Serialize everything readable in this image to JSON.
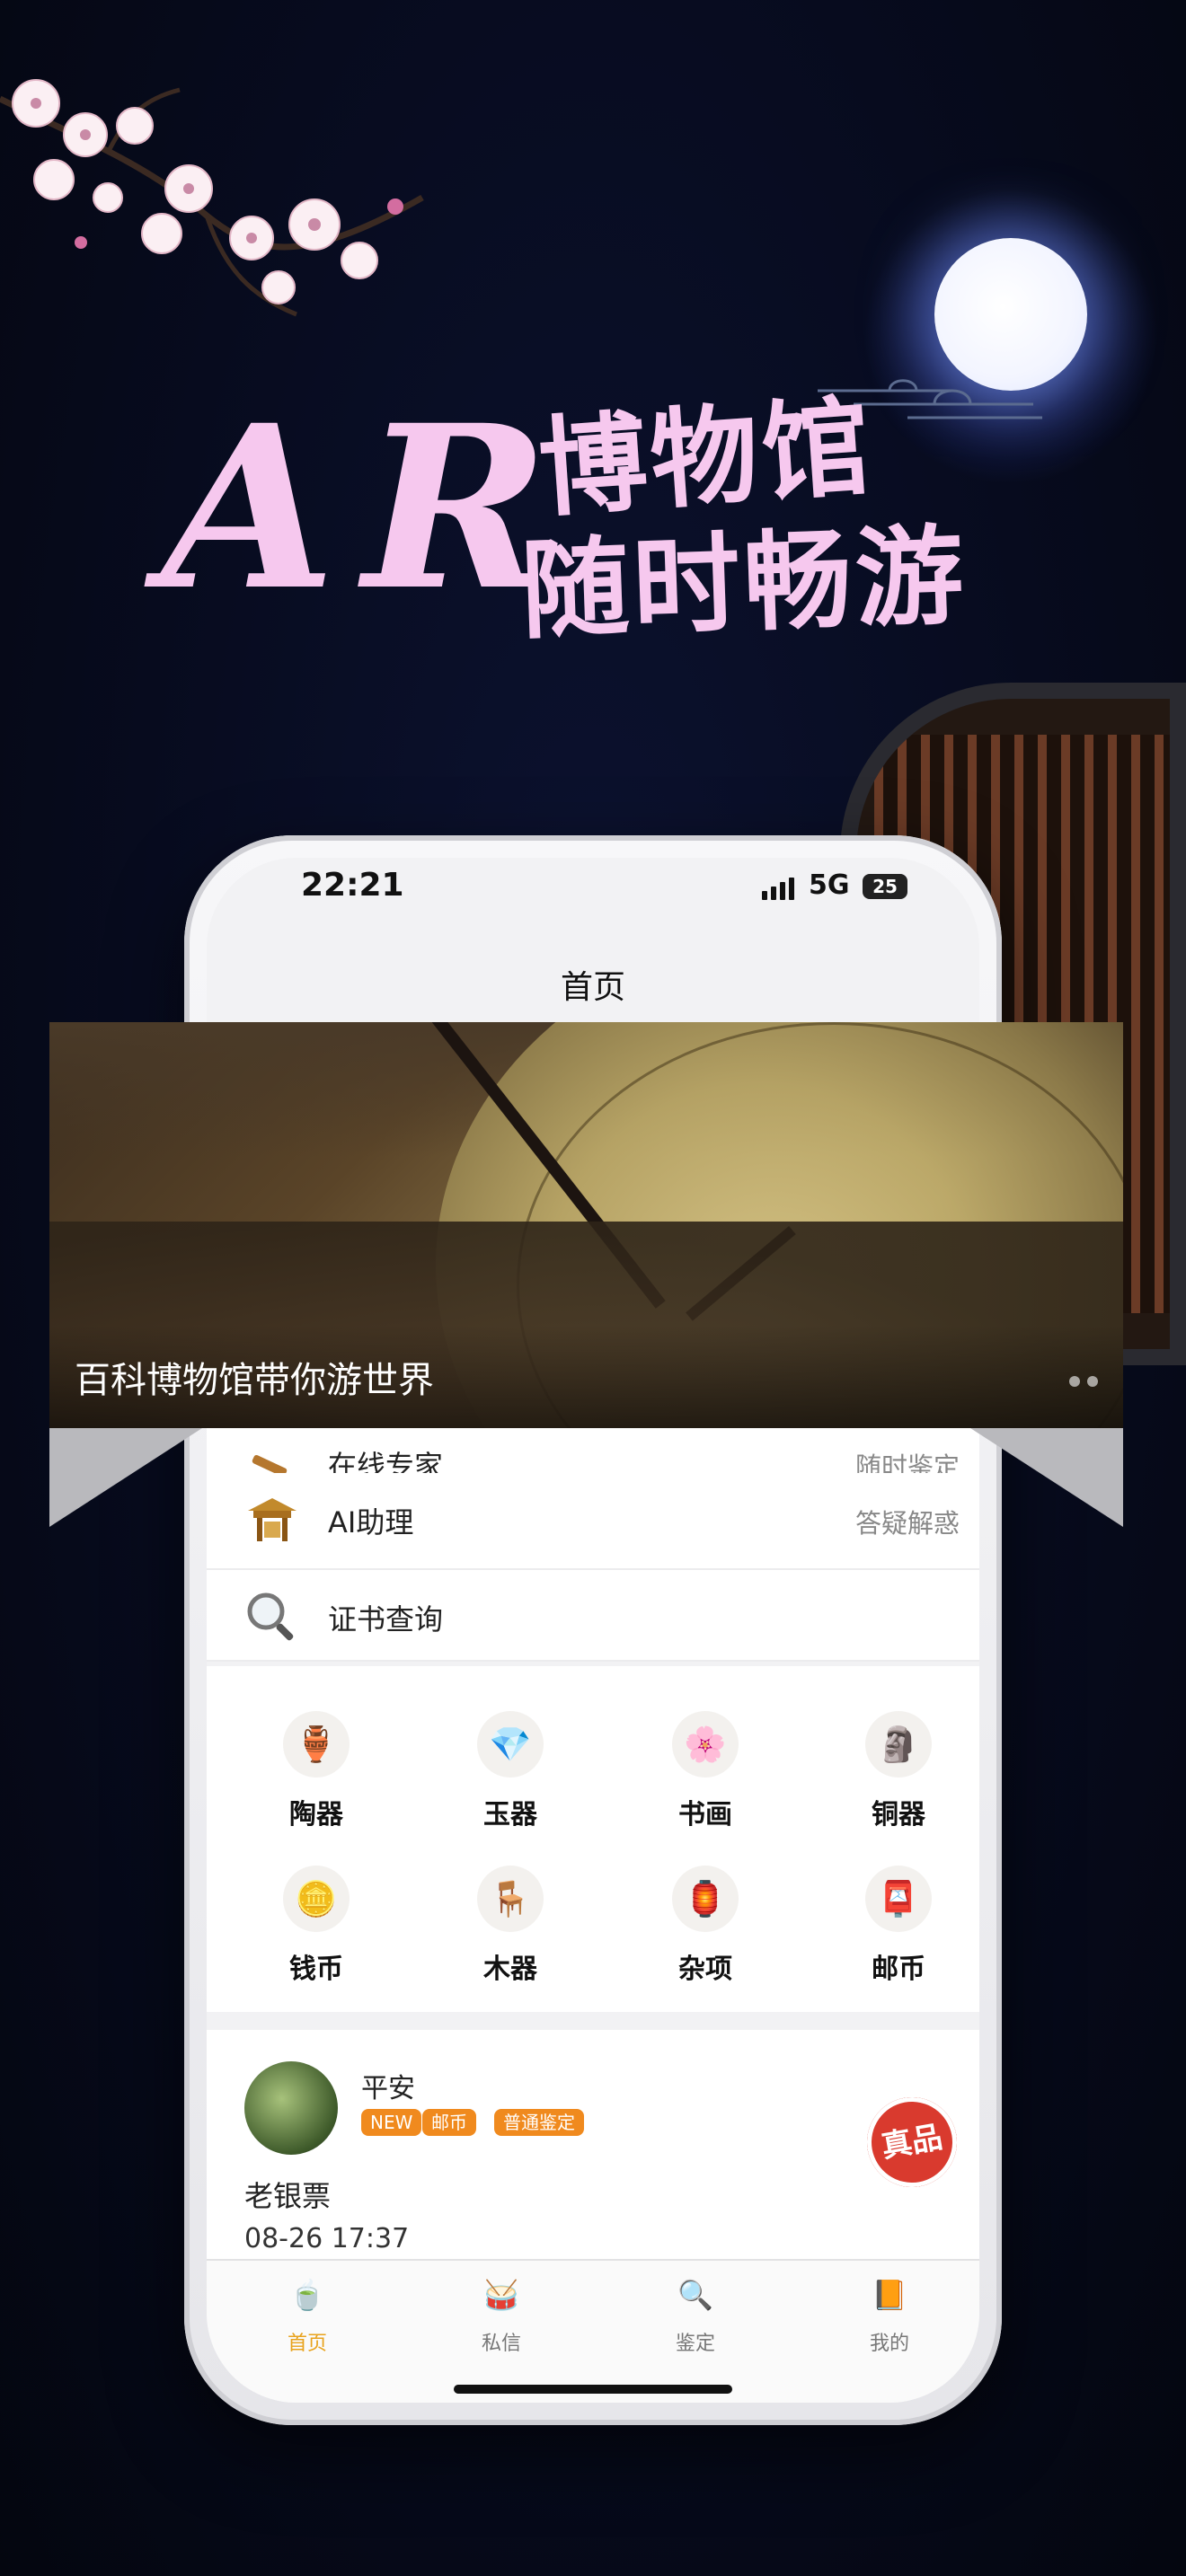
{
  "hero": {
    "ar_text": "AR",
    "line1": "博物馆",
    "line2": "随时畅游"
  },
  "status_bar": {
    "time": "22:21",
    "network": "5G",
    "battery": "25"
  },
  "nav": {
    "title": "首页"
  },
  "banner": {
    "caption": "百科博物馆带你游世界",
    "page_count": 2
  },
  "menu": [
    {
      "label": "在线专家",
      "hint": "随时鉴定",
      "icon": "gavel-icon"
    },
    {
      "label": "AI助理",
      "hint": "答疑解惑",
      "icon": "pavilion-icon"
    },
    {
      "label": "证书查询",
      "hint": "",
      "icon": "magnifier-icon"
    }
  ],
  "categories": [
    {
      "label": "陶器",
      "icon": "vase-icon",
      "glyph": "🏺"
    },
    {
      "label": "玉器",
      "icon": "jade-icon",
      "glyph": "💎"
    },
    {
      "label": "书画",
      "icon": "painting-icon",
      "glyph": "🌸"
    },
    {
      "label": "铜器",
      "icon": "bronze-buddha-icon",
      "glyph": "🗿"
    },
    {
      "label": "钱币",
      "icon": "coin-icon",
      "glyph": "🪙"
    },
    {
      "label": "木器",
      "icon": "wood-furniture-icon",
      "glyph": "🪑"
    },
    {
      "label": "杂项",
      "icon": "misc-icon",
      "glyph": "🏮"
    },
    {
      "label": "邮币",
      "icon": "stamp-icon",
      "glyph": "📮"
    }
  ],
  "post": {
    "user": "平安",
    "tags": [
      "NEW",
      "邮币",
      "普通鉴定"
    ],
    "title": "老银票",
    "time": "08-26 17:37",
    "seal": "真品"
  },
  "tabs": [
    {
      "label": "首页",
      "icon": "home-bowl-icon",
      "glyph": "🍵",
      "active": true
    },
    {
      "label": "私信",
      "icon": "message-drum-icon",
      "glyph": "🥁",
      "active": false
    },
    {
      "label": "鉴定",
      "icon": "appraise-icon",
      "glyph": "🔍",
      "active": false
    },
    {
      "label": "我的",
      "icon": "profile-icon",
      "glyph": "📙",
      "active": false
    }
  ],
  "colors": {
    "accent": "#e8a21c",
    "tag": "#f08a1e",
    "hero_text": "#f6c8ee",
    "seal": "#d93a2e"
  }
}
